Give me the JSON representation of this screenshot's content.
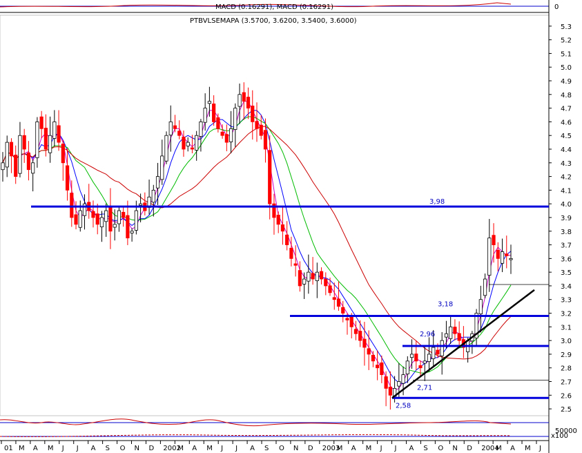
{
  "macd": {
    "label": "MACD (0.16291), MACD (0.16291)",
    "zero_label": "0"
  },
  "price_title": "PTBVLSEMAPA (3.5700, 3.6200, 3.5400, 3.6000)",
  "volume_label": "x100",
  "volume_tick": "50000",
  "colors": {
    "up": "#000000",
    "down": "#ff0000",
    "ma_short": "#cc00cc",
    "ma_mid": "#0000ff",
    "ma_long1": "#00bb00",
    "ma_long2": "#cc0000",
    "support": "#0000dd",
    "trend": "#000000"
  },
  "chart_data": {
    "type": "candlestick",
    "title": "PTBVLSEMAPA (3.5700, 3.6200, 3.5400, 3.6000)",
    "y_ticks": [
      "2.5",
      "2.6",
      "2.7",
      "2.8",
      "2.9",
      "3.0",
      "3.1",
      "3.2",
      "3.3",
      "3.4",
      "3.5",
      "3.6",
      "3.7",
      "3.8",
      "3.9",
      "4.0",
      "4.1",
      "4.2",
      "4.3",
      "4.4",
      "4.5",
      "4.6",
      "4.7",
      "4.8",
      "4.9",
      "5.0",
      "5.1",
      "5.2",
      "5.3"
    ],
    "ylim": [
      2.45,
      5.38
    ],
    "x_ticks": [
      "01",
      "M",
      "A",
      "M",
      "J",
      "J",
      "A",
      "S",
      "O",
      "N",
      "D",
      "2002",
      "M",
      "A",
      "M",
      "J",
      "J",
      "A",
      "S",
      "O",
      "N",
      "D",
      "2003",
      "M",
      "A",
      "M",
      "J",
      "J",
      "A",
      "S",
      "O",
      "N",
      "D",
      "2004",
      "M",
      "A",
      "M",
      "J"
    ],
    "levels": [
      {
        "value": 3.98,
        "label": "3,98"
      },
      {
        "value": 3.18,
        "label": "3,18"
      },
      {
        "value": 2.96,
        "label": "2,96"
      },
      {
        "value": 2.58,
        "label": "2,58"
      }
    ],
    "minor_levels": [
      {
        "value": 3.41,
        "label": ""
      },
      {
        "value": 2.71,
        "label": "2,71"
      }
    ],
    "trendline": {
      "from": {
        "date_index": 121,
        "value": 2.58
      },
      "to": {
        "date_index": 159,
        "value": 3.37
      }
    },
    "series_close": [
      4.3,
      4.45,
      4.35,
      4.2,
      4.5,
      4.4,
      4.25,
      4.3,
      4.6,
      4.55,
      4.4,
      4.5,
      4.6,
      4.45,
      4.3,
      4.1,
      3.9,
      3.85,
      3.95,
      4.0,
      3.95,
      3.9,
      3.85,
      3.9,
      3.95,
      3.8,
      3.85,
      3.95,
      3.9,
      3.75,
      3.8,
      3.95,
      4.0,
      3.95,
      4.05,
      4.1,
      4.2,
      4.35,
      4.5,
      4.6,
      4.55,
      4.5,
      4.4,
      4.45,
      4.4,
      4.5,
      4.6,
      4.7,
      4.75,
      4.6,
      4.55,
      4.5,
      4.45,
      4.55,
      4.7,
      4.8,
      4.75,
      4.7,
      4.6,
      4.55,
      4.5,
      4.4,
      4.0,
      3.9,
      3.85,
      3.8,
      3.7,
      3.6,
      3.55,
      3.4,
      3.45,
      3.5,
      3.45,
      3.5,
      3.45,
      3.4,
      3.35,
      3.3,
      3.25,
      3.2,
      3.15,
      3.1,
      3.05,
      3.0,
      2.95,
      2.9,
      2.85,
      2.8,
      2.75,
      2.65,
      2.6,
      2.65,
      2.7,
      2.75,
      2.85,
      2.9,
      2.85,
      2.8,
      2.85,
      2.9,
      2.95,
      2.9,
      3.0,
      3.05,
      3.1,
      3.05,
      3.0,
      2.95,
      3.0,
      3.05,
      3.2,
      3.3,
      3.45,
      3.75,
      3.7,
      3.6,
      3.65,
      3.62,
      3.6
    ]
  }
}
